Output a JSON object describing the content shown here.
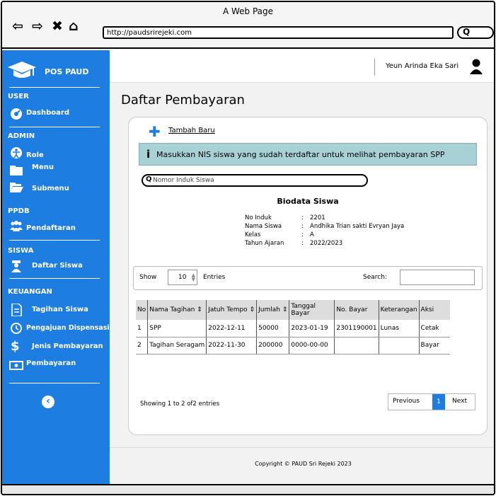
{
  "browser": {
    "title": "A Web Page",
    "url": "http://paudsrirejeki.com",
    "nav_icons": [
      "back-arrow-icon",
      "forward-arrow-icon",
      "close-icon",
      "home-icon"
    ]
  },
  "sidebar": {
    "brand": "POS PAUD",
    "sections": {
      "user": "USER",
      "admin": "ADMIN",
      "ppdb": "PPDB",
      "siswa": "SISWA",
      "keuangan": "KEUANGAN"
    },
    "items": {
      "dashboard": "Dashboard",
      "role": "Role",
      "menu": "Menu",
      "submenu": "Submenu",
      "pendaftaran": "Pendaftaran",
      "daftar_siswa": "Daftar Siswa",
      "tagihan_siswa": "Tagihan Siswa",
      "pengajuan_dispensasi": "Pengajuan Dispensasi",
      "jenis_pembayaran": "Jenis Pembayaran",
      "pembayaran": "Pembayaran"
    },
    "collapse_glyph": "‹"
  },
  "header": {
    "user_name": "Yeun Arinda Eka Sari"
  },
  "page": {
    "title": "Daftar Pembayaran",
    "add_new": "Tambah Baru",
    "info": "Masukkan NIS siswa yang sudah  terdaftar untuk melihat pembayaran SPP",
    "nis_placeholder": "Nomor Induk Siswa",
    "biodata_title": "Biodata Siswa",
    "biodata": {
      "no_induk_label": "No Induk",
      "no_induk": "2201",
      "nama_label": "Nama Siswa",
      "nama": "Andhika Trian sakti Evryan Jaya",
      "kelas_label": "Kelas",
      "kelas": "A",
      "tahun_label": "Tahun Ajaran",
      "tahun": "2022/2023"
    },
    "show_label": "Show",
    "entries_value": "10",
    "entries_label": "Entries",
    "search_label": "Search:",
    "table": {
      "headers": [
        "No",
        "Nama Tagihan ⇕",
        "Jatuh Tempo ⇕",
        "Jumlah ⇕",
        "Tanggal Bayar",
        "No. Bayar",
        "Keterangan",
        "Aksi"
      ],
      "rows": [
        [
          "1",
          "SPP",
          "2022-12-11",
          "50000",
          "2023-01-19",
          "2301190001",
          "Lunas",
          "Cetak"
        ],
        [
          "2",
          "Tagihan Seragam",
          "2022-11-30",
          "200000",
          "0000-00-00",
          "",
          "",
          "Bayar"
        ]
      ]
    },
    "showing": "Showing 1 to 2 of2 entries",
    "pager": {
      "previous": "Previous",
      "current": "1",
      "next": "Next"
    }
  },
  "footer": "Copyright © PAUD Sri Rejeki 2023",
  "colors": {
    "sidebar": "#1e7de0",
    "info": "#a8d1d5",
    "background": "#f2f2f2"
  }
}
